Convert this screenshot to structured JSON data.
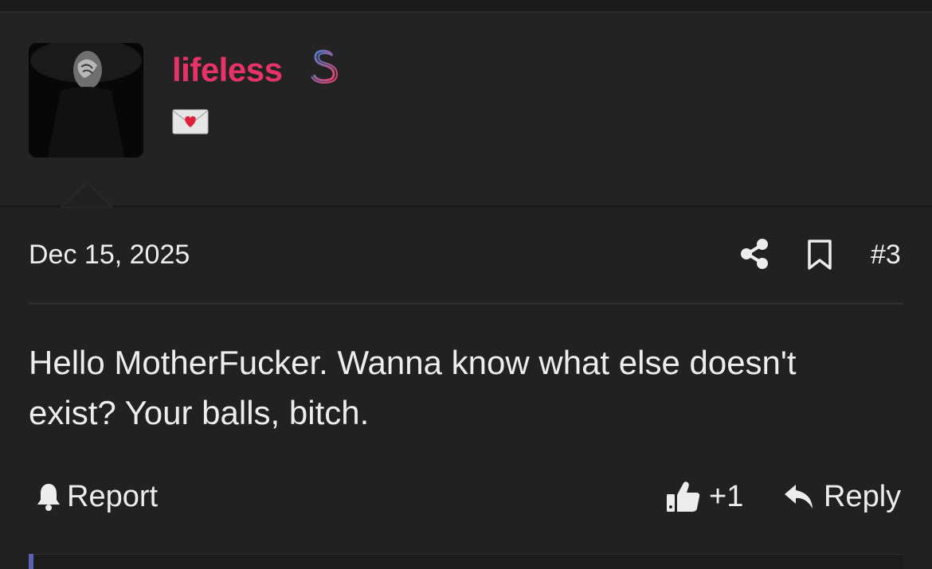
{
  "post": {
    "author": {
      "username": "lifeless",
      "username_color": "#e8336a",
      "badges": [
        "dollar-sign-icon",
        "love-letter-icon"
      ]
    },
    "date": "Dec 15, 2025",
    "post_number": "#3",
    "body_line1": "Hello MotherFucker. Wanna know what else doesn't",
    "body_line2": "exist? Your balls, bitch.",
    "actions": {
      "report_label": "Report",
      "like_count": "+1",
      "reply_label": "Reply"
    }
  },
  "colors": {
    "background": "#212121",
    "text": "#ededed",
    "accent": "#5a60b8"
  }
}
